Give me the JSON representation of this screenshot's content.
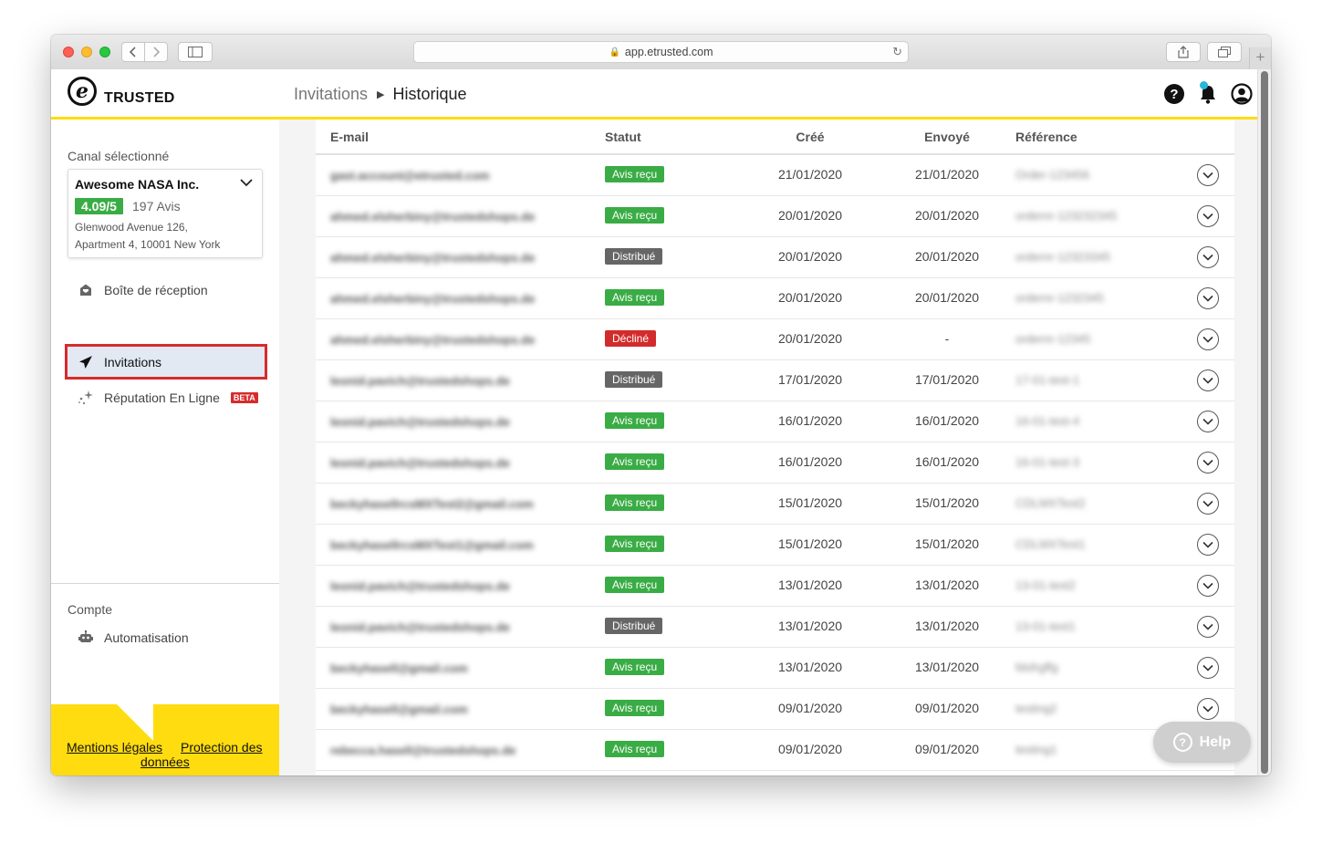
{
  "browser": {
    "url": "app.etrusted.com"
  },
  "header": {
    "logo_text": "TRUSTED",
    "logo_mark": "e",
    "breadcrumb_parent": "Invitations",
    "breadcrumb_separator": "▶",
    "breadcrumb_current": "Historique",
    "icons": [
      "help-icon",
      "bell-icon",
      "account-icon"
    ],
    "notification_color": "#29b6d9"
  },
  "sidebar": {
    "channel_label": "Canal sélectionné",
    "channel": {
      "name": "Awesome NASA Inc.",
      "score": "4.09/5",
      "reviews": "197 Avis",
      "address_line1": "Glenwood Avenue 126,",
      "address_line2": "Apartment 4, 10001 New York"
    },
    "nav": [
      {
        "label": "Boîte de réception",
        "icon": "inbox-icon"
      },
      {
        "label": "Invitations",
        "icon": "paper-plane-icon",
        "active": true
      },
      {
        "label": "Réputation En Ligne",
        "icon": "sparkle-icon",
        "badge": "BETA"
      }
    ],
    "account_label": "Compte",
    "account_items": [
      {
        "label": "Automatisation",
        "icon": "robot-icon"
      }
    ],
    "footer": {
      "legal": "Mentions légales",
      "privacy_line1": "Protection des",
      "privacy_line2": "données"
    }
  },
  "table": {
    "headers": {
      "email": "E-mail",
      "status": "Statut",
      "created": "Créé",
      "sent": "Envoyé",
      "reference": "Référence"
    },
    "rows": [
      {
        "email": "gast.account@etrusted.com",
        "status": "Avis reçu",
        "status_type": "avis",
        "created": "21/01/2020",
        "sent": "21/01/2020",
        "reference": "Order-123456"
      },
      {
        "email": "ahmed.elsherbiny@trustedshops.de",
        "status": "Avis reçu",
        "status_type": "avis",
        "created": "20/01/2020",
        "sent": "20/01/2020",
        "reference": "ordernr-123232345"
      },
      {
        "email": "ahmed.elsherbiny@trustedshops.de",
        "status": "Distribué",
        "status_type": "dist",
        "created": "20/01/2020",
        "sent": "20/01/2020",
        "reference": "ordernr-12323345"
      },
      {
        "email": "ahmed.elsherbiny@trustedshops.de",
        "status": "Avis reçu",
        "status_type": "avis",
        "created": "20/01/2020",
        "sent": "20/01/2020",
        "reference": "ordernr-1232345"
      },
      {
        "email": "ahmed.elsherbiny@trustedshops.de",
        "status": "Décliné",
        "status_type": "decl",
        "created": "20/01/2020",
        "sent": "-",
        "reference": "ordernr-12345"
      },
      {
        "email": "leonid.pavich@trustedshops.de",
        "status": "Distribué",
        "status_type": "dist",
        "created": "17/01/2020",
        "sent": "17/01/2020",
        "reference": "17-01-test-1"
      },
      {
        "email": "leonid.pavich@trustedshops.de",
        "status": "Avis reçu",
        "status_type": "avis",
        "created": "16/01/2020",
        "sent": "16/01/2020",
        "reference": "16-01-test-4"
      },
      {
        "email": "leonid.pavich@trustedshops.de",
        "status": "Avis reçu",
        "status_type": "avis",
        "created": "16/01/2020",
        "sent": "16/01/2020",
        "reference": "16-01-test-3"
      },
      {
        "email": "beckyhasellrcsMXTest2@gmail.com",
        "status": "Avis reçu",
        "status_type": "avis",
        "created": "15/01/2020",
        "sent": "15/01/2020",
        "reference": "CDLMXTest2"
      },
      {
        "email": "beckyhasellrcsMXTest1@gmail.com",
        "status": "Avis reçu",
        "status_type": "avis",
        "created": "15/01/2020",
        "sent": "15/01/2020",
        "reference": "CDLMXTest1"
      },
      {
        "email": "leonid.pavich@trustedshops.de",
        "status": "Avis reçu",
        "status_type": "avis",
        "created": "13/01/2020",
        "sent": "13/01/2020",
        "reference": "13-01-test2"
      },
      {
        "email": "leonid.pavich@trustedshops.de",
        "status": "Distribué",
        "status_type": "dist",
        "created": "13/01/2020",
        "sent": "13/01/2020",
        "reference": "13-01-test1"
      },
      {
        "email": "beckyhasell@gmail.com",
        "status": "Avis reçu",
        "status_type": "avis",
        "created": "13/01/2020",
        "sent": "13/01/2020",
        "reference": "fdsfrgffg"
      },
      {
        "email": "beckyhasell@gmail.com",
        "status": "Avis reçu",
        "status_type": "avis",
        "created": "09/01/2020",
        "sent": "09/01/2020",
        "reference": "testing2"
      },
      {
        "email": "rebecca.hasell@trustedshops.de",
        "status": "Avis reçu",
        "status_type": "avis",
        "created": "09/01/2020",
        "sent": "09/01/2020",
        "reference": "testing1"
      }
    ]
  },
  "help_button": {
    "label": "Help"
  },
  "colors": {
    "accent_yellow": "#ffdc0f",
    "success_green": "#3aac45",
    "neutral_gray": "#666666",
    "danger_red": "#d32b2b"
  }
}
